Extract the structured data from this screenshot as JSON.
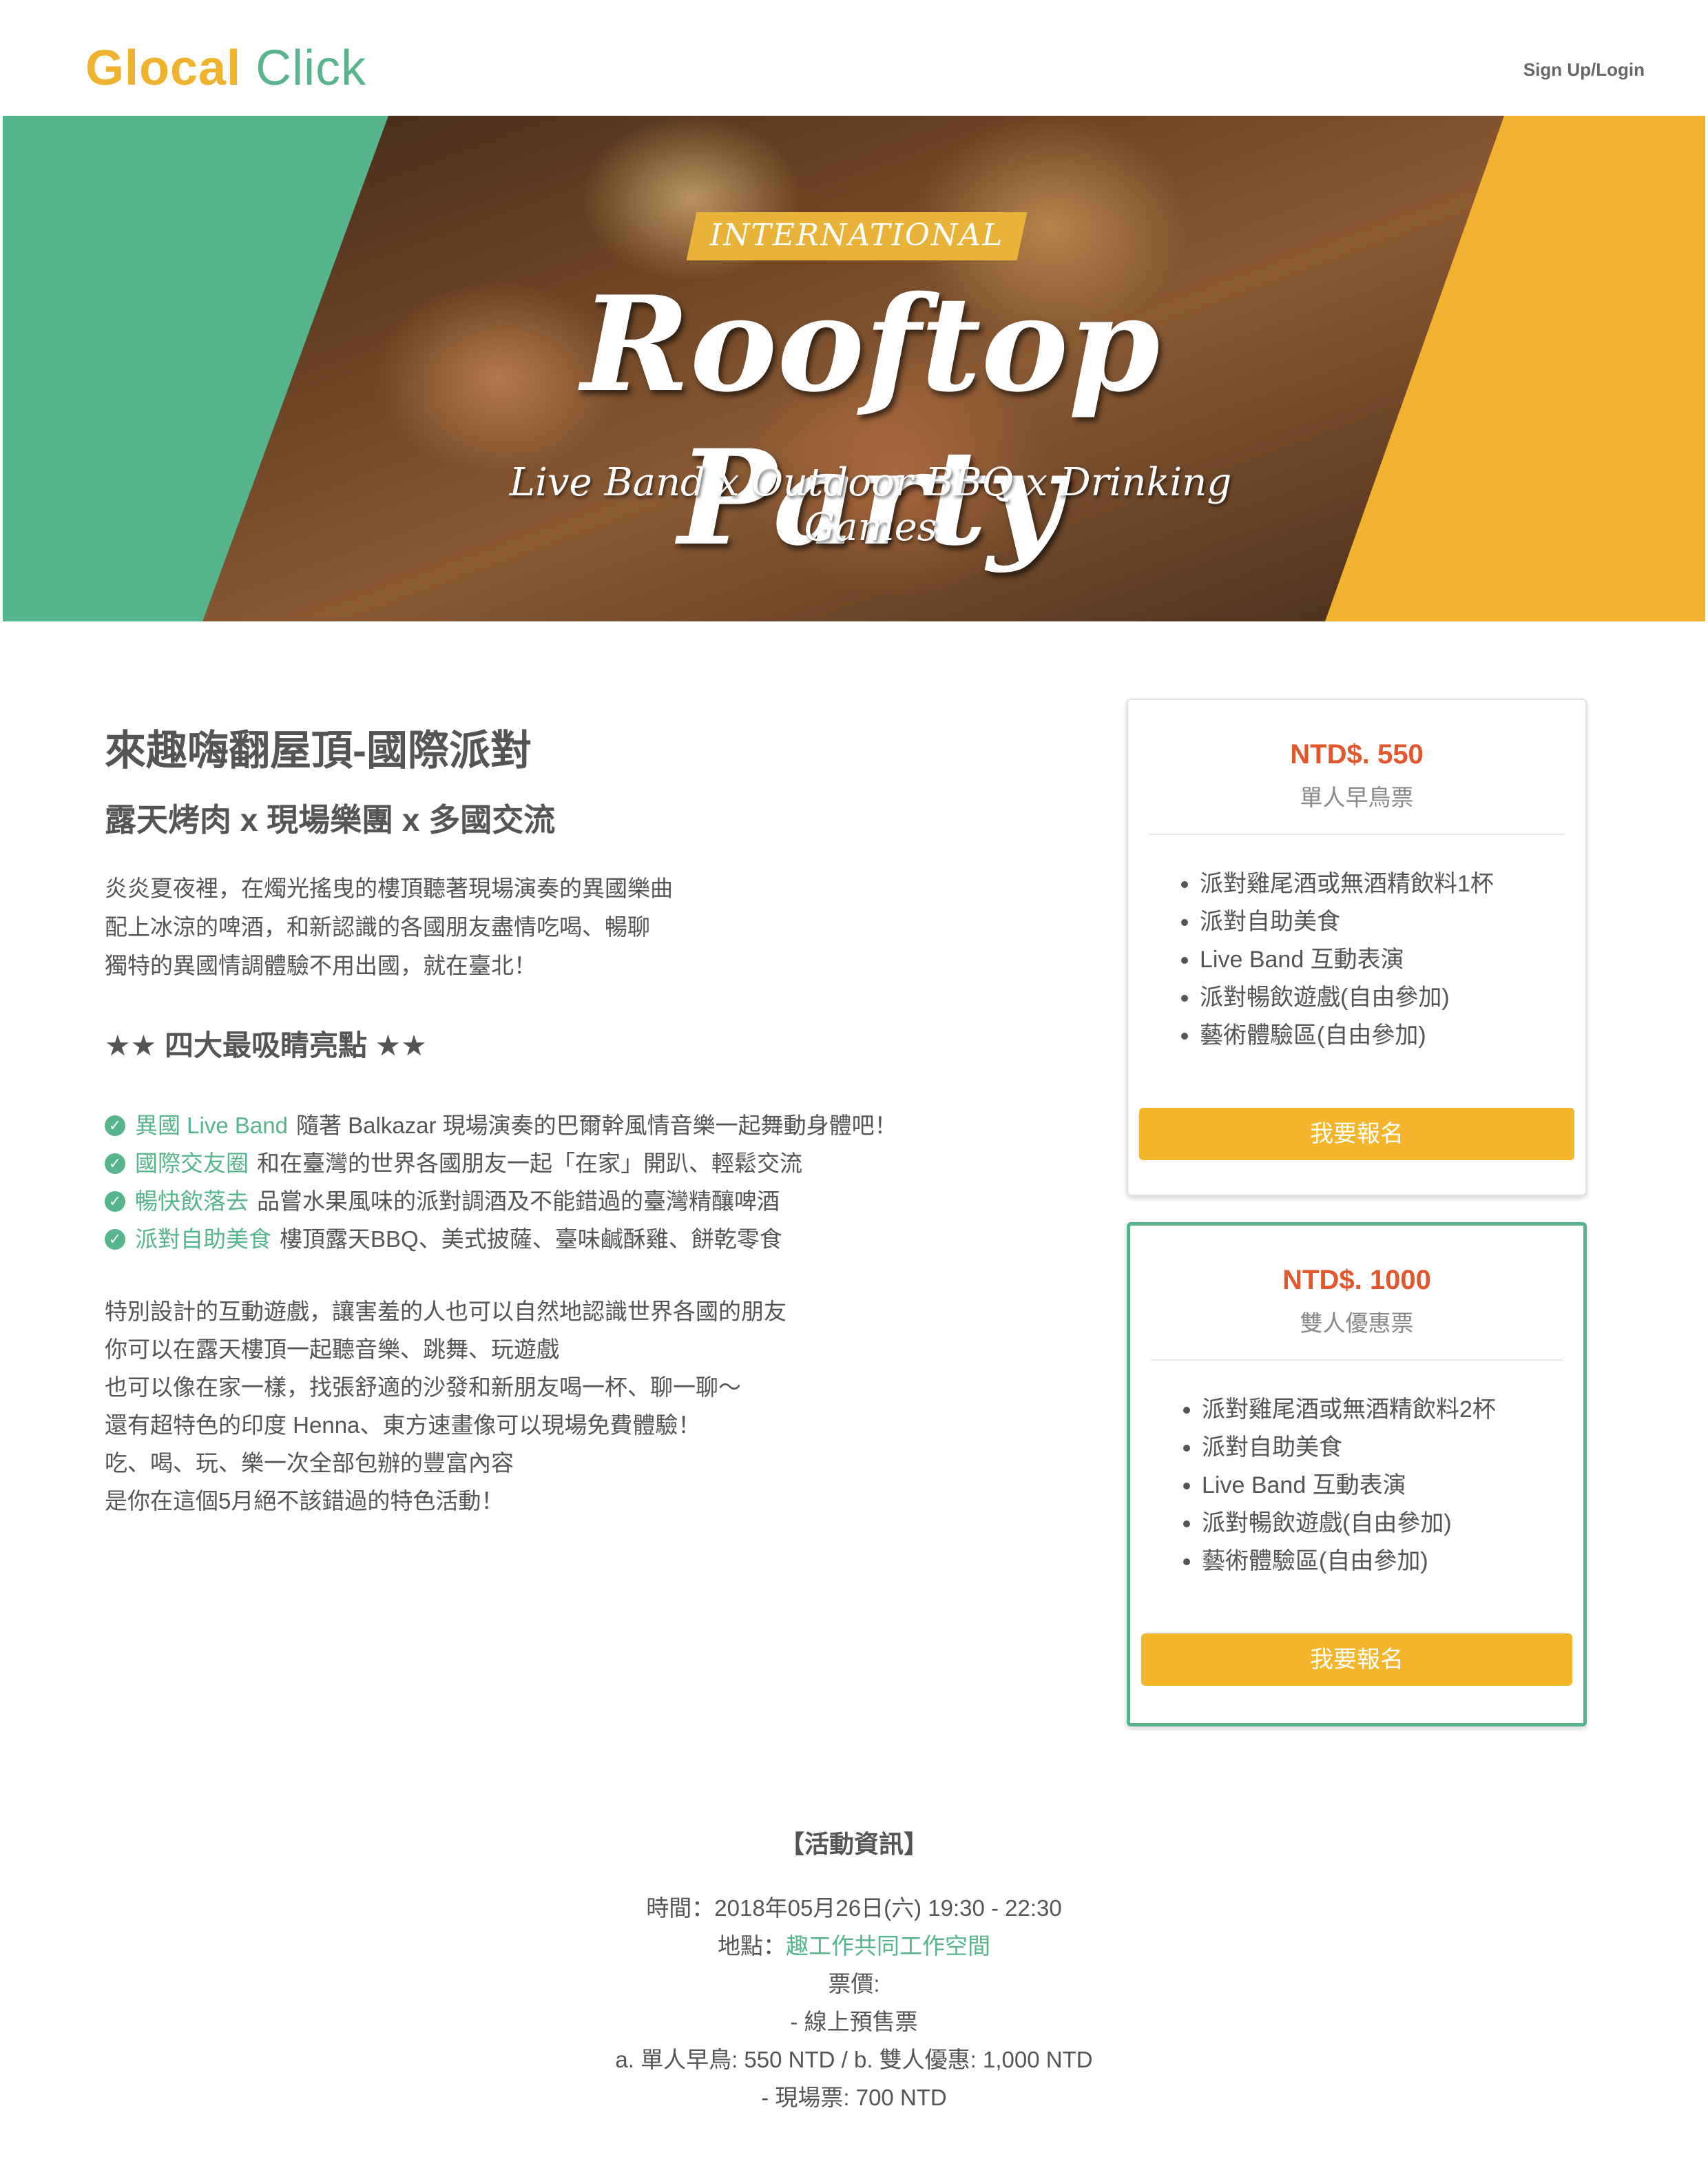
{
  "header": {
    "logo_part1": "Glocal",
    "logo_part2": "Click",
    "login_label": "Sign Up/Login"
  },
  "banner": {
    "tag": "INTERNATIONAL",
    "title": "Rooftop Party",
    "subtitle": "Live Band x Outdoor BBQ x Drinking Games",
    "colors": {
      "left": "#57B58D",
      "right": "#F0B22F"
    }
  },
  "event": {
    "title": "來趣嗨翻屋頂-國際派對",
    "subtitle": "露天烤肉 x 現場樂團 x 多國交流",
    "intro": [
      "炎炎夏夜裡，在燭光搖曳的樓頂聽著現場演奏的異國樂曲",
      "配上冰涼的啤酒，和新認識的各國朋友盡情吃喝、暢聊",
      "獨特的異國情調體驗不用出國，就在臺北！"
    ],
    "highlights_heading": "★★ 四大最吸睛亮點 ★★",
    "highlights": [
      {
        "label": "異國 Live Band",
        "text": "隨著 Balkazar 現場演奏的巴爾幹風情音樂一起舞動身體吧！"
      },
      {
        "label": "國際交友圈",
        "text": "和在臺灣的世界各國朋友一起「在家」開趴、輕鬆交流"
      },
      {
        "label": "暢快飲落去",
        "text": "品嘗水果風味的派對調酒及不能錯過的臺灣精釀啤酒"
      },
      {
        "label": "派對自助美食",
        "text": "樓頂露天BBQ、美式披薩、臺味鹹酥雞、餅乾零食"
      }
    ],
    "description": [
      "特別設計的互動遊戲，讓害羞的人也可以自然地認識世界各國的朋友",
      "你可以在露天樓頂一起聽音樂、跳舞、玩遊戲",
      "也可以像在家一樣，找張舒適的沙發和新朋友喝一杯、聊一聊～",
      "還有超特色的印度 Henna、東方速畫像可以現場免費體驗！",
      "吃、喝、玩、樂一次全部包辦的豐富內容",
      "是你在這個5月絕不該錯過的特色活動！"
    ]
  },
  "tickets": [
    {
      "price": "NTD$. 550",
      "name": "單人早鳥票",
      "perks": [
        "派對雞尾酒或無酒精飲料1杯",
        "派對自助美食",
        "Live Band 互動表演",
        "派對暢飲遊戲(自由參加)",
        "藝術體驗區(自由參加)"
      ],
      "button": "我要報名"
    },
    {
      "price": "NTD$. 1000",
      "name": "雙人優惠票",
      "perks": [
        "派對雞尾酒或無酒精飲料2杯",
        "派對自助美食",
        "Live Band 互動表演",
        "派對暢飲遊戲(自由參加)",
        "藝術體驗區(自由參加)"
      ],
      "button": "我要報名"
    }
  ],
  "info": {
    "heading": "【活動資訊】",
    "time": "時間：2018年05月26日(六) 19:30 - 22:30",
    "location_label": "地點：",
    "location_link": "趣工作共同工作空間",
    "price_label": "票價:",
    "presale": "- 線上預售票",
    "presale_detail": "a. 單人早鳥: 550 NTD / b. 雙人優惠: 1,000 NTD",
    "door": "- 現場票: 700 NTD"
  },
  "colors": {
    "accent_green": "#57B58D",
    "accent_yellow": "#F5B52B",
    "price_orange": "#E2572B"
  }
}
